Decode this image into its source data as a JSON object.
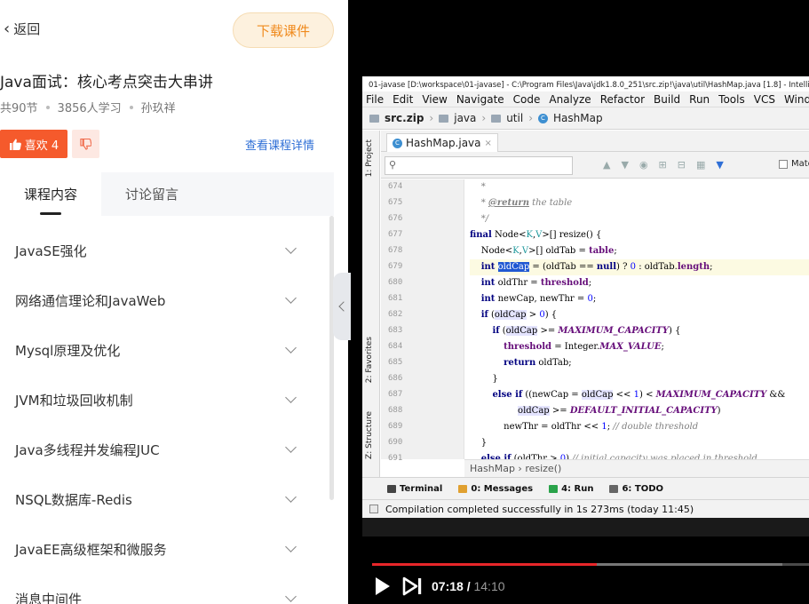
{
  "header": {
    "back_label": "返回",
    "download_label": "下载课件"
  },
  "course": {
    "title": "Java面试：核心考点突击大串讲",
    "lessons": "共90节",
    "learners": "3856人学习",
    "author": "孙玖祥",
    "like_label": "喜欢 4",
    "detail_link": "查看课程详情"
  },
  "tabs": [
    {
      "label": "课程内容",
      "active": true
    },
    {
      "label": "讨论留言",
      "active": false
    }
  ],
  "chapters": [
    "JavaSE强化",
    "网络通信理论和JavaWeb",
    "Mysql原理及优化",
    "JVM和垃圾回收机制",
    "Java多线程并发编程JUC",
    "NSQL数据库-Redis",
    "JavaEE高级框架和微服务",
    "消息中间件"
  ],
  "ide": {
    "title_bar": "01-javase [D:\\workspace\\01-javase] - C:\\Program Files\\Java\\jdk1.8.0_251\\src.zip!\\java\\util\\HashMap.java [1.8] - Intelli",
    "menu": [
      "File",
      "Edit",
      "View",
      "Navigate",
      "Code",
      "Analyze",
      "Refactor",
      "Build",
      "Run",
      "Tools",
      "VCS",
      "Window"
    ],
    "breadcrumbs": [
      "src.zip",
      "java",
      "util",
      "HashMap"
    ],
    "file_tab": "HashMap.java",
    "match_case_label": "Match C",
    "side_tools": [
      "1: Project",
      "2: Favorites",
      "Z: Structure"
    ],
    "line_numbers": [
      "674",
      "675",
      "676",
      "677",
      "678",
      "679",
      "680",
      "681",
      "682",
      "683",
      "684",
      "685",
      "686",
      "687",
      "688",
      "689",
      "690",
      "691"
    ],
    "method_crumb": "HashMap  ›  resize()",
    "tool_windows": [
      "Terminal",
      "0: Messages",
      "4: Run",
      "6: TODO"
    ],
    "status_message": "Compilation completed successfully in 1s 273ms (today 11:45)"
  },
  "player": {
    "current_time": "07:18 /",
    "duration": "14:10",
    "progress": 0.515,
    "buffered": 0.94,
    "accent_color": "#e8262a"
  }
}
